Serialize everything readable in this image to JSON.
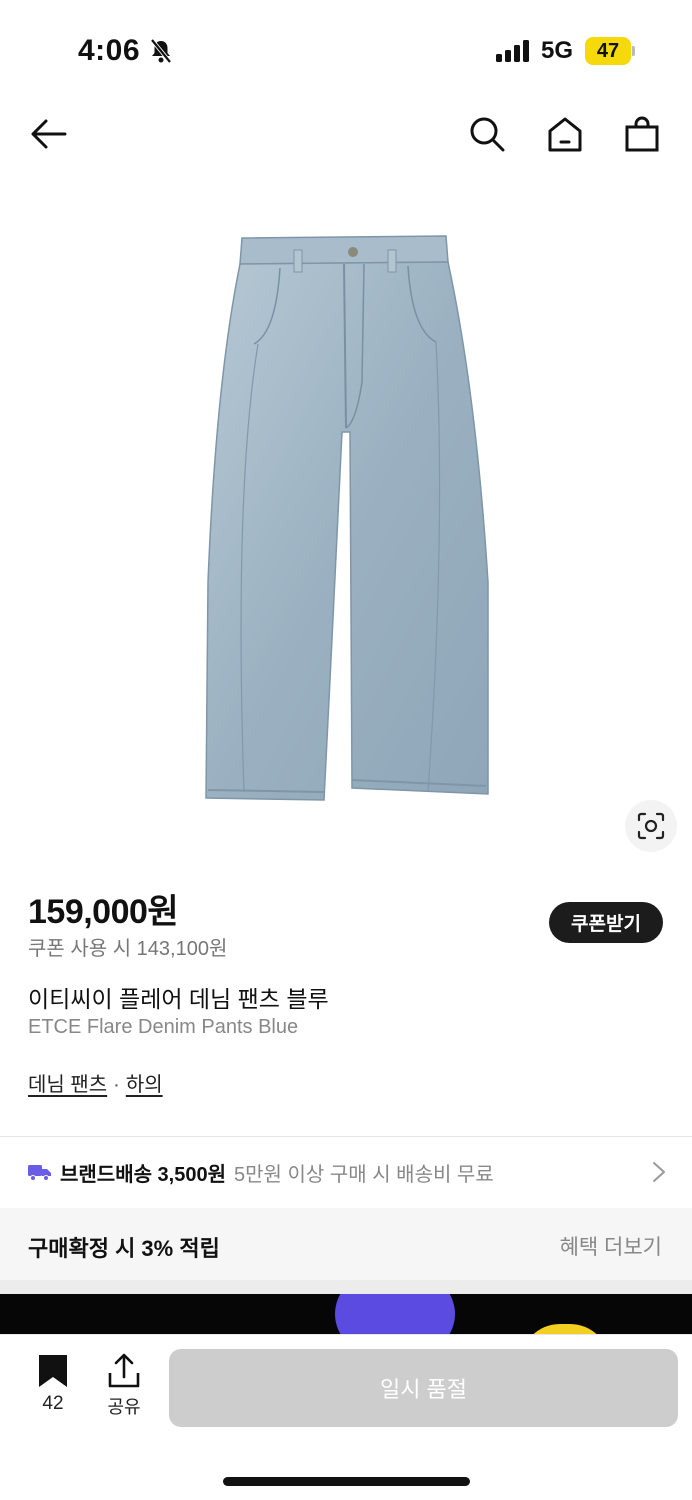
{
  "status": {
    "time": "4:06",
    "network": "5G",
    "battery": "47"
  },
  "nav": {
    "icons": [
      "back-arrow-icon",
      "search-icon",
      "home-icon",
      "shopping-bag-icon"
    ]
  },
  "product": {
    "price": "159,000원",
    "coupon_price": "쿠폰 사용 시 143,100원",
    "coupon_button": "쿠폰받기",
    "name_ko": "이티씨이 플레어 데님 팬츠 블루",
    "name_en": "ETCE Flare Denim Pants Blue",
    "categories": [
      "데님 팬츠",
      "하의"
    ],
    "category_separator": "·"
  },
  "shipping": {
    "label": "브랜드배송 3,500원",
    "note": "5만원 이상 구매 시 배송비 무료"
  },
  "points": {
    "label": "구매확정 시 3% 적립",
    "more": "혜택 더보기"
  },
  "bottom_bar": {
    "bookmark_count": "42",
    "share_label": "공유",
    "buy_button": "일시 품절"
  },
  "colors": {
    "accent_truck": "#6b5ce7",
    "coupon_button_bg": "#1c1c1c",
    "disabled_button_bg": "#cdcdcd",
    "battery_bg": "#f5d90a",
    "denim": "#9fb5c4"
  }
}
